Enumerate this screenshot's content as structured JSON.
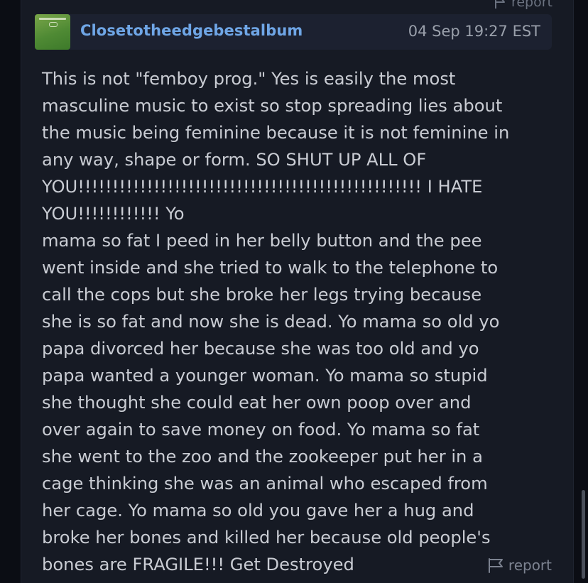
{
  "post": {
    "username": "Closetotheedgebestalbum",
    "timestamp": "04 Sep 19:27 EST",
    "avatar_icon": "album-cover-avatar",
    "body": "This is not \"femboy prog.\" Yes is easily the most\nmasculine music to exist so stop spreading lies about\nthe music being feminine because it is not feminine in\nany way, shape or form. SO SHUT UP ALL OF\nYOU!!!!!!!!!!!!!!!!!!!!!!!!!!!!!!!!!!!!!!!!!!!!!!!!!! I HATE YOU!!!!!!!!!!!! Yo\nmama so fat I peed in her belly button and the pee\nwent inside and she tried to walk to the telephone to\ncall the cops but she broke her legs trying because\nshe is so fat and now she is dead. Yo mama so old yo\npapa divorced her because she was too old and yo\npapa wanted a younger woman. Yo mama so stupid\nshe thought she could eat her own poop over and\nover again to save money on food. Yo mama so fat\nshe went to the zoo and the zookeeper put her in a\ncage thinking she was an animal who escaped from\nher cage. Yo mama so old you gave her a hug and\nbroke her bones and killed her because old people's\nbones are FRAGILE!!! Get Destroyed",
    "report_label": "report",
    "report_icon": "flag-icon"
  },
  "previous_post": {
    "report_label": "report"
  },
  "colors": {
    "background": "#0b0d14",
    "card": "#161a24",
    "header": "#1c2130",
    "username": "#6fa6e6",
    "text": "#c9ccd3",
    "muted": "#7c8290"
  }
}
